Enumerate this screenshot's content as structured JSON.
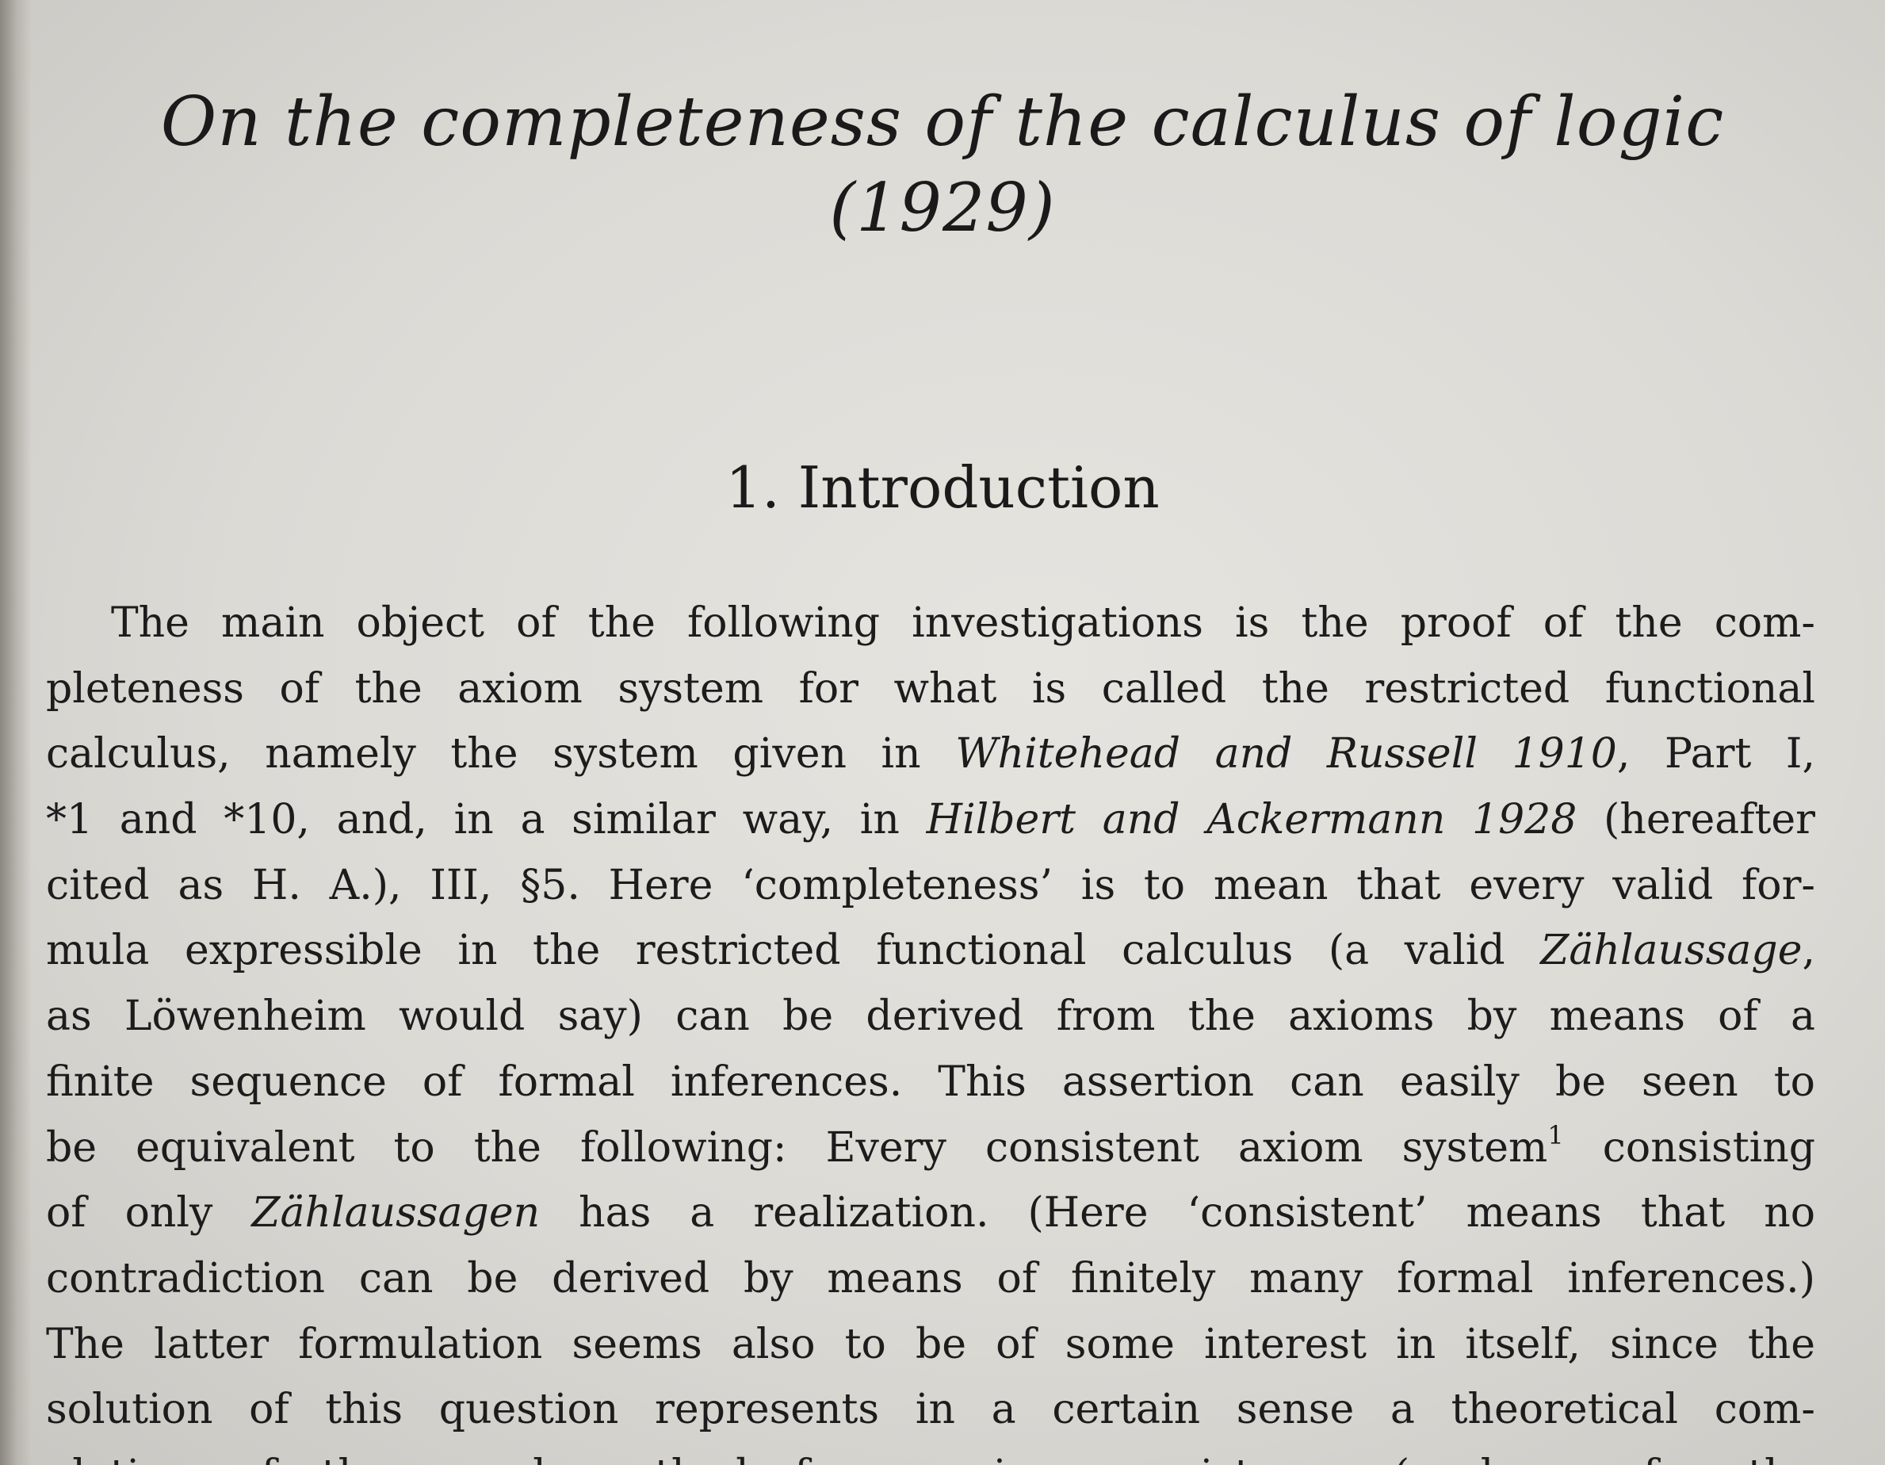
{
  "title": {
    "main": "On the completeness of the calculus of logic",
    "year": "(1929)"
  },
  "section": {
    "heading": "1. Introduction"
  },
  "paragraph": {
    "lines": [
      [
        "The main object of the following investigations is the proof of the com-"
      ],
      [
        "pleteness of the axiom system for what is called the restricted functional"
      ],
      [
        "calculus, namely the system given in ",
        {
          "i": "Whitehead and Russell 1910"
        },
        ", Part I,"
      ],
      [
        "*1 and *10, and, in a similar way, in ",
        {
          "i": "Hilbert and Ackermann 1928"
        },
        " (hereafter"
      ],
      [
        "cited as H. A.), III, §5. Here ‘completeness’ is to mean that every valid for-"
      ],
      [
        "mula expressible in the restricted functional calculus (a valid ",
        {
          "i": "Zählaussage"
        },
        ","
      ],
      [
        "as Löwenheim would say) can be derived from the axioms by means of a"
      ],
      [
        "finite sequence of formal inferences. This assertion can easily be seen to"
      ],
      [
        "be equivalent to the following: Every consistent axiom system",
        {
          "sup": "1"
        },
        " consisting"
      ],
      [
        "of only ",
        {
          "i": "Zählaussagen"
        },
        " has a realization. (Here ‘consistent’ means that no"
      ],
      [
        "contradiction can be derived by means of finitely many formal inferences.)"
      ],
      [
        "The latter formulation seems also to be of some interest in itself, since the"
      ],
      [
        "solution of this question represents in a certain sense a theoretical com-"
      ],
      [
        "pletion of the usual method for proving consistency (such as for the"
      ]
    ]
  }
}
